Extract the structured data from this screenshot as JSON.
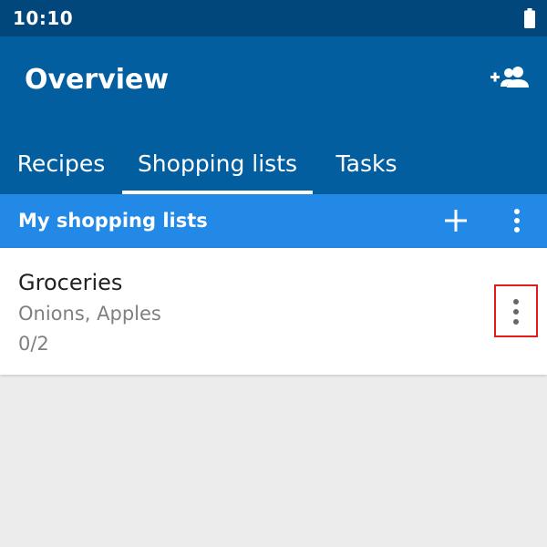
{
  "status_bar": {
    "time": "10:10",
    "battery_icon": "battery-full-icon"
  },
  "app_bar": {
    "title": "Overview",
    "action_icon": "add-person-icon"
  },
  "tabs": [
    {
      "label": "Recipes",
      "selected": false
    },
    {
      "label": "Shopping lists",
      "selected": true
    },
    {
      "label": "Tasks",
      "selected": false
    }
  ],
  "list_header": {
    "title": "My shopping lists",
    "add_icon": "plus-icon",
    "more_icon": "more-vert-icon"
  },
  "shopping_lists": [
    {
      "name": "Groceries",
      "items": "Onions, Apples",
      "progress": "0/2",
      "more_icon": "more-vert-icon"
    }
  ],
  "colors": {
    "status_bar": "#02477c",
    "app_bar": "#025e9f",
    "list_header": "#2289e6",
    "background": "#ececec",
    "highlight": "#e31b1b"
  }
}
